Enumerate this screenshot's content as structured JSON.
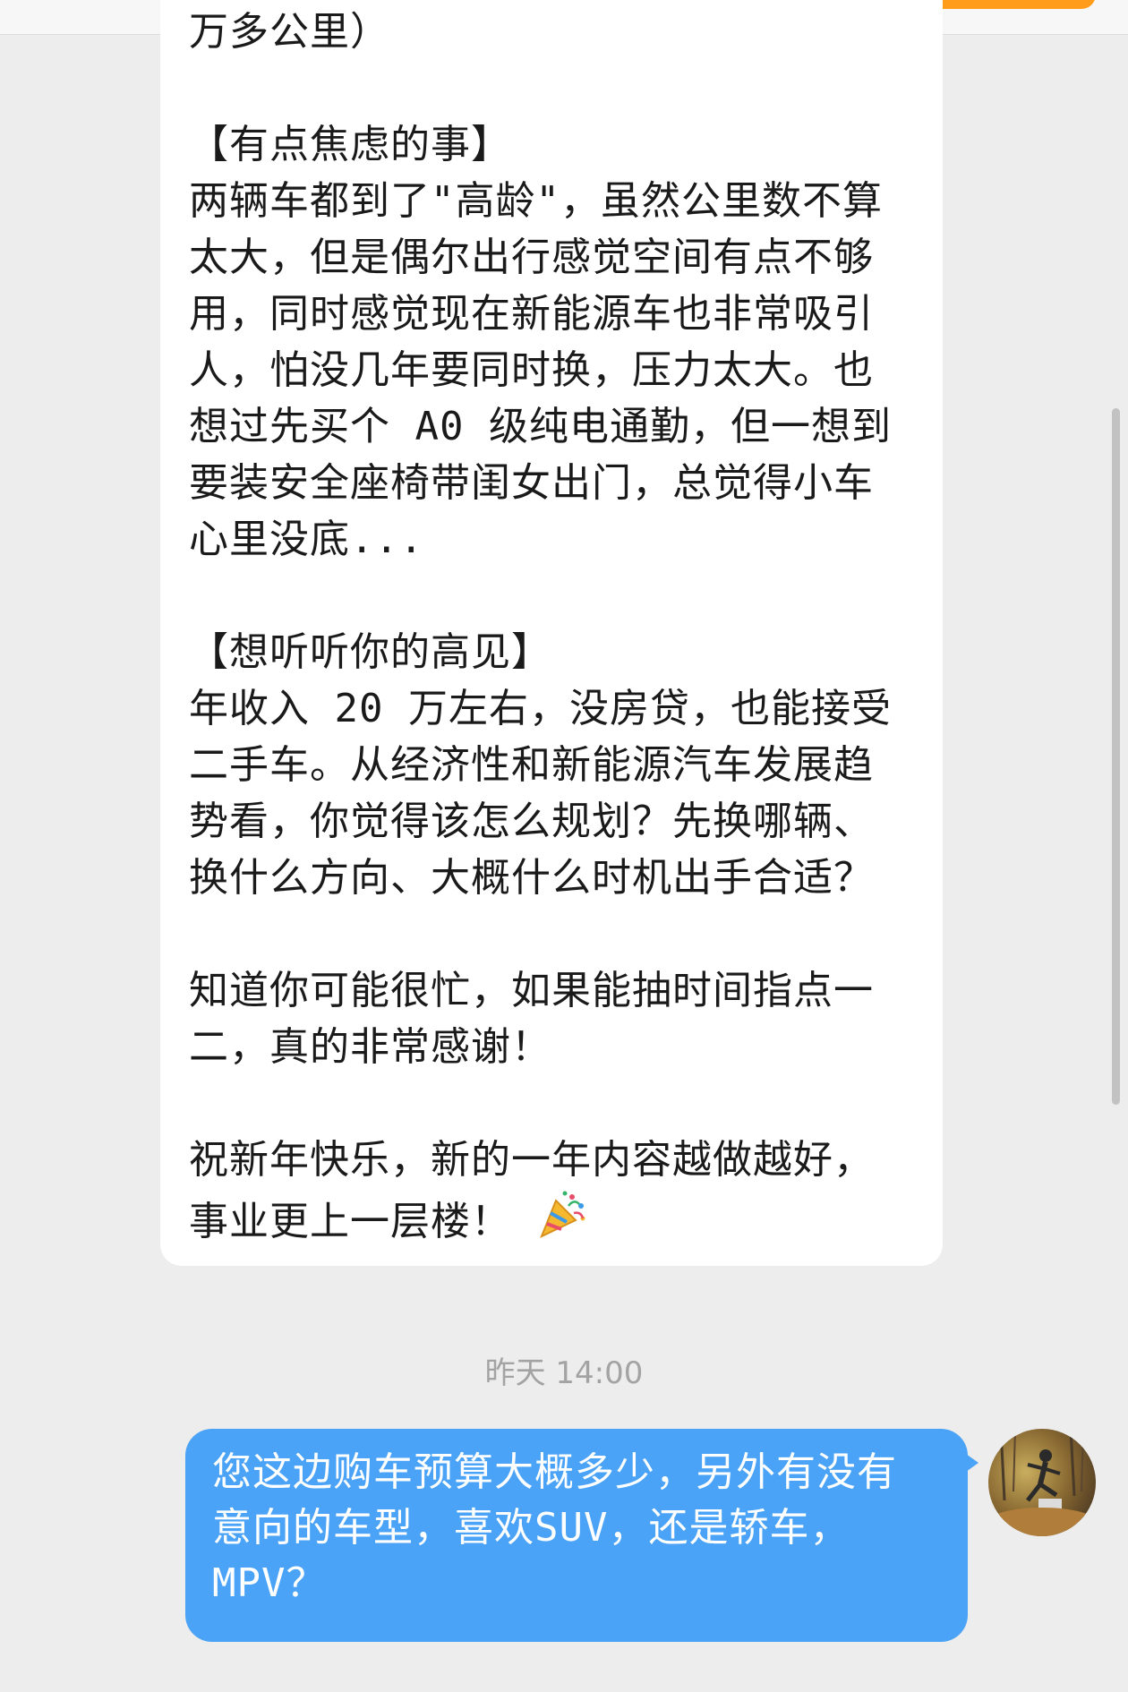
{
  "incoming_message": {
    "lines": [
      "万多公里）",
      "",
      "【有点焦虑的事】",
      "两辆车都到了\"高龄\"，虽然公里数不算",
      "太大，但是偶尔出行感觉空间有点不够",
      "用，同时感觉现在新能源车也非常吸引",
      "人，怕没几年要同时换，压力太大。也",
      "想过先买个 A0 级纯电通勤，但一想到",
      "要装安全座椅带闺女出门，总觉得小车",
      "心里没底...",
      "",
      "【想听听你的高见】",
      "年收入 20 万左右，没房贷，也能接受",
      "二手车。从经济性和新能源汽车发展趋",
      "势看，你觉得该怎么规划？先换哪辆、",
      "换什么方向、大概什么时机出手合适？",
      "",
      "知道你可能很忙，如果能抽时间指点一",
      "二，真的非常感谢！",
      "",
      "祝新年快乐，新的一年内容越做越好，"
    ],
    "last_line": "事业更上一层楼！",
    "emoji_icon": "party-popper-icon"
  },
  "timestamp": "昨天 14:00",
  "outgoing_message": {
    "lines": [
      "您这边购车预算大概多少，另外有没有",
      "意向的车型，喜欢SUV，还是轿车，",
      "MPV？"
    ]
  },
  "avatar": {
    "icon": "user-avatar-photo"
  },
  "colors": {
    "background": "#ededed",
    "incoming_bubble": "#ffffff",
    "outgoing_bubble": "#4aa3f7",
    "accent": "#ff9d1a"
  }
}
